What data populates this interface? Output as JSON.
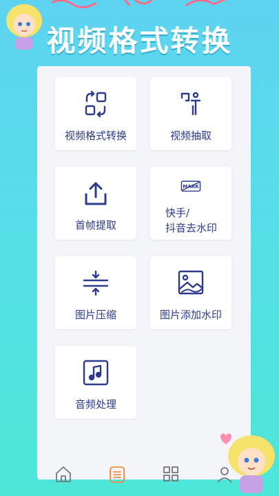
{
  "header": {
    "title": "视频格式转换"
  },
  "tools": [
    {
      "label": "视频格式转换",
      "icon": "convert-icon"
    },
    {
      "label": "视频抽取",
      "icon": "extract-icon"
    },
    {
      "label": "首帧提取",
      "icon": "upload-icon"
    },
    {
      "label_line1": "快手/",
      "label_line2": "抖音去水印",
      "icon": "mark-icon"
    },
    {
      "label": "图片压缩",
      "icon": "compress-icon"
    },
    {
      "label": "图片添加水印",
      "icon": "image-icon"
    },
    {
      "label": "音频处理",
      "icon": "music-icon"
    }
  ],
  "bottom_nav": [
    {
      "icon": "home-icon",
      "active": false
    },
    {
      "icon": "list-icon",
      "active": true
    },
    {
      "icon": "grid-icon",
      "active": false
    },
    {
      "icon": "user-icon",
      "active": false
    }
  ],
  "colors": {
    "accent": "#2b3a8c",
    "active_nav": "#f08a3c",
    "bg_top": "#5ed3f0",
    "bg_bottom": "#4de7d7"
  }
}
